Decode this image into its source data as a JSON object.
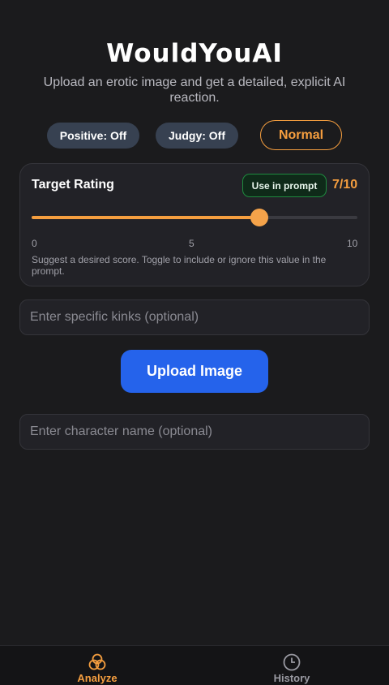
{
  "header": {
    "title": "WouldYouAI",
    "subtitle": "Upload an erotic image and get a detailed, explicit AI reaction."
  },
  "toggles": {
    "positive_label": "Positive: Off",
    "judgy_label": "Judgy: Off",
    "mode_label": "Normal"
  },
  "rating": {
    "label": "Target Rating",
    "use_in_prompt_label": "Use in prompt",
    "value_text": "7/10",
    "value": 7,
    "min": 0,
    "max": 10,
    "ticks": [
      "0",
      "5",
      "10"
    ],
    "hint": "Suggest a desired score. Toggle to include or ignore this value in the prompt."
  },
  "inputs": {
    "kinks_placeholder": "Enter specific kinks (optional)",
    "kinks_value": "",
    "character_placeholder": "Enter character name (optional)",
    "character_value": ""
  },
  "upload": {
    "label": "Upload Image"
  },
  "nav": {
    "items": [
      {
        "label": "Analyze",
        "icon": "three-circles-icon",
        "active": true
      },
      {
        "label": "History",
        "icon": "clock-icon",
        "active": false
      }
    ]
  },
  "colors": {
    "accent": "#f59e3f",
    "primary_button": "#2563eb",
    "background": "#1b1b1d",
    "prompt_toggle_border": "#1f8a3f"
  }
}
